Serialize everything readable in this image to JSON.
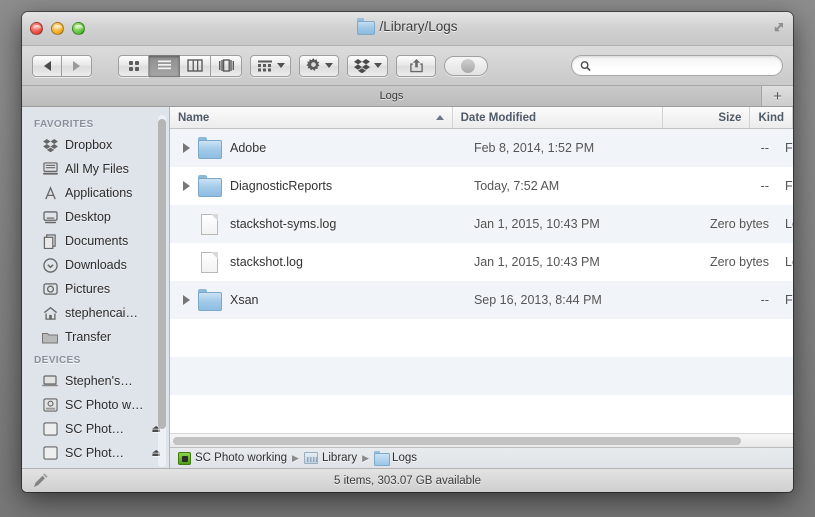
{
  "window": {
    "title": "/Library/Logs",
    "title_icon": "folder-icon",
    "fullscreen_icon": "fullscreen-icon",
    "traffic_lights": [
      "close-button",
      "minimize-button",
      "zoom-button"
    ]
  },
  "toolbar": {
    "back_label": "◀",
    "forward_label": "▶",
    "view_modes": [
      {
        "name": "icon-view",
        "active": false
      },
      {
        "name": "list-view",
        "active": true
      },
      {
        "name": "column-view",
        "active": false
      },
      {
        "name": "coverflow-view",
        "active": false
      }
    ],
    "arrange_icon": "arrange-icon",
    "action_icon": "gear-icon",
    "dropbox_icon": "dropbox-icon",
    "share_icon": "share-icon",
    "tag_icon": "tag-toggle",
    "search": {
      "value": "",
      "placeholder": ""
    }
  },
  "tabbar": {
    "tabs": [
      {
        "label": "Logs",
        "active": true
      }
    ],
    "add_label": "+"
  },
  "sidebar": {
    "sections": [
      {
        "header": "FAVORITES",
        "items": [
          {
            "label": "Dropbox",
            "icon": "dropbox-icon",
            "eject": false
          },
          {
            "label": "All My Files",
            "icon": "all-my-files-icon",
            "eject": false
          },
          {
            "label": "Applications",
            "icon": "applications-icon",
            "eject": false
          },
          {
            "label": "Desktop",
            "icon": "desktop-icon",
            "eject": false
          },
          {
            "label": "Documents",
            "icon": "documents-icon",
            "eject": false
          },
          {
            "label": "Downloads",
            "icon": "downloads-icon",
            "eject": false
          },
          {
            "label": "Pictures",
            "icon": "pictures-icon",
            "eject": false
          },
          {
            "label": "stephencai…",
            "icon": "home-icon",
            "eject": false
          },
          {
            "label": "Transfer",
            "icon": "folder-icon",
            "eject": false
          }
        ]
      },
      {
        "header": "DEVICES",
        "items": [
          {
            "label": "Stephen's…",
            "icon": "laptop-icon",
            "eject": false
          },
          {
            "label": "SC Photo w…",
            "icon": "drive-icon",
            "eject": false
          },
          {
            "label": "SC Phot…",
            "icon": "ext-drive-icon",
            "eject": true
          },
          {
            "label": "SC Phot…",
            "icon": "ext-drive-icon",
            "eject": true
          }
        ]
      }
    ],
    "eject_glyph": "⏏"
  },
  "filelist": {
    "columns": [
      {
        "key": "name",
        "label": "Name",
        "sorted": true,
        "sort_dir": "asc"
      },
      {
        "key": "date",
        "label": "Date Modified",
        "sorted": false
      },
      {
        "key": "size",
        "label": "Size",
        "sorted": false
      },
      {
        "key": "kind",
        "label": "Kind",
        "sorted": false
      }
    ],
    "rows": [
      {
        "name": "Adobe",
        "date": "Feb 8, 2014, 1:52 PM",
        "size": "--",
        "kind": "Folder",
        "icon": "folder-icon",
        "expandable": true
      },
      {
        "name": "DiagnosticReports",
        "date": "Today, 7:52 AM",
        "size": "--",
        "kind": "Folder",
        "icon": "folder-icon",
        "expandable": true
      },
      {
        "name": "stackshot-syms.log",
        "date": "Jan 1, 2015, 10:43 PM",
        "size": "Zero bytes",
        "kind": "Log",
        "icon": "document-icon",
        "expandable": false
      },
      {
        "name": "stackshot.log",
        "date": "Jan 1, 2015, 10:43 PM",
        "size": "Zero bytes",
        "kind": "Log",
        "icon": "document-icon",
        "expandable": false
      },
      {
        "name": "Xsan",
        "date": "Sep 16, 2013, 8:44 PM",
        "size": "--",
        "kind": "Folder",
        "icon": "folder-icon",
        "expandable": true
      }
    ]
  },
  "pathbar": {
    "crumbs": [
      {
        "label": "SC Photo working",
        "icon": "green-drive-icon"
      },
      {
        "label": "Library",
        "icon": "library-icon"
      },
      {
        "label": "Logs",
        "icon": "folder-icon"
      }
    ],
    "separator": "▶"
  },
  "statusbar": {
    "text": "5 items, 303.07 GB available",
    "tool_icon": "pen-icon"
  }
}
